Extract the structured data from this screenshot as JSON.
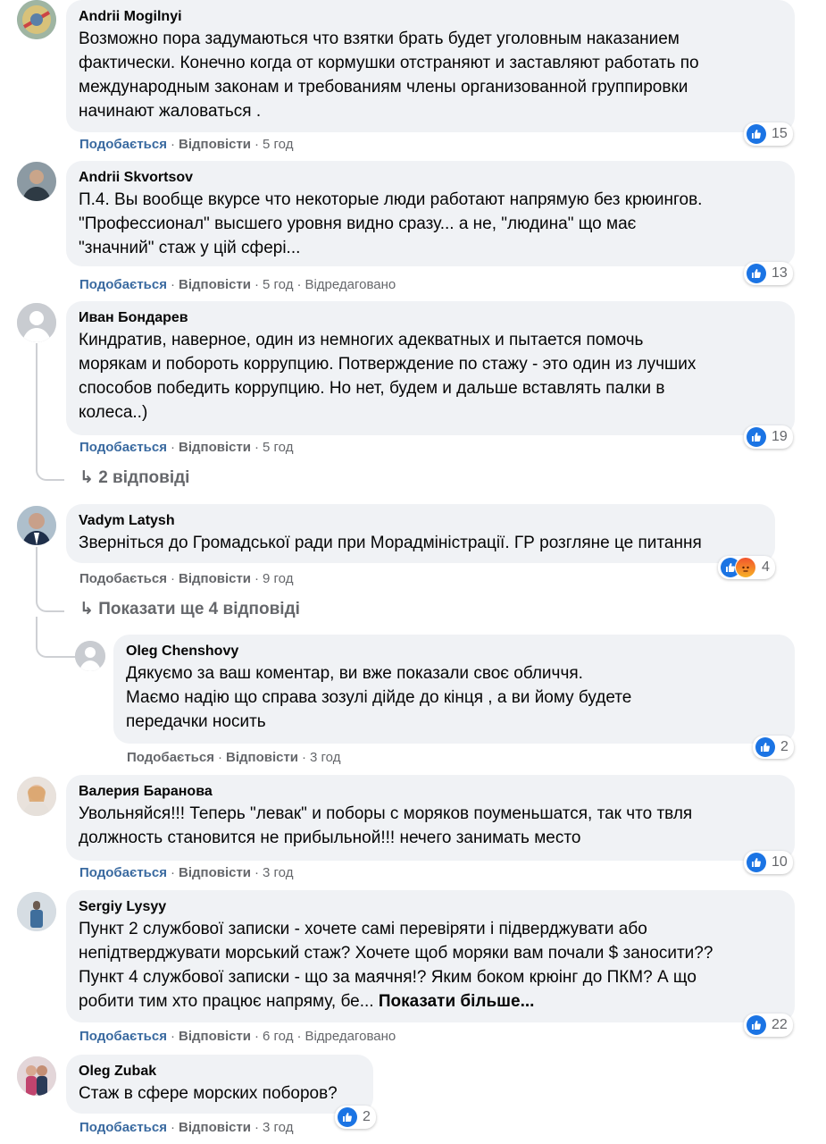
{
  "labels": {
    "like": "Подобається",
    "reply": "Відповісти",
    "edited": "Відредаговано"
  },
  "comments": [
    {
      "author": "Andrii Mogilnyi",
      "text": "Возможно пора задумаються что взятки брать будет уголовным наказанием\nфактически. Конечно когда от кормушки отстраняют и заставляют работать по\nмеждународным законам и требованиям члены организованной группировки\nначинают жаловаться .",
      "time": "5 год",
      "reactions": "15"
    },
    {
      "author": "Andrii Skvortsov",
      "text": "П.4. Вы вообще вкурсе что некоторые люди работают напрямую без крюингов.\n\"Профессионал\" высшего уровня видно сразу... а не, \"людина\" що має\n\"значний\" стаж у цій сфері...",
      "time": "5 год",
      "edited": true,
      "reactions": "13"
    },
    {
      "author": "Иван Бондарев",
      "text": "Киндратив, наверное, один из немногих адекватных и пытается помочь\nморякам и побороть коррупцию. Потверждение по стажу - это один из лучших\nспособов победить коррупцию. Но нет, будем и дальше вставлять палки в\nколеса..)",
      "time": "5 год",
      "reactions": "19",
      "replies_link": "2 відповіді"
    },
    {
      "author": "Vadym Latysh",
      "text": "Зверніться до Громадської ради при Морадміністрації. ГР розгляне це питання",
      "time": "9 год",
      "reactions": "4",
      "replies_link": "Показати ще 4 відповіді"
    },
    {
      "author": "Oleg Chenshovy",
      "text": "Дякуємо за ваш коментар, ви вже показали своє обличчя.\nМаємо надію що справа зозулі дійде до кінця , а ви йому будете\nпередачки носить",
      "time": "3 год",
      "reactions": "2"
    },
    {
      "author": "Валерия Баранова",
      "text": "Увольняйся!!! Теперь \"левак\" и поборы с моряков поуменьшатся, так что твля\nдолжность становится не прибыльной!!! нечего занимать место",
      "time": "3 год",
      "reactions": "10"
    },
    {
      "author": "Sergiy Lysyy",
      "text": "Пункт 2 службової записки - хочете самі перевіряти і підверджувати або\nнепідтверджувати морський стаж? Хочете щоб моряки вам почали $ заносити??\nПункт 4 службової записки - що за маячня!? Яким боком крюінг до ПКМ? А що\nробити тим хто працює напряму, бе...",
      "more": "Показати більше...",
      "time": "6 год",
      "edited": true,
      "reactions": "22"
    },
    {
      "author": "Oleg Zubak",
      "text": "Стаж в сфере морских поборов?",
      "time": "3 год",
      "reactions": "2"
    }
  ]
}
